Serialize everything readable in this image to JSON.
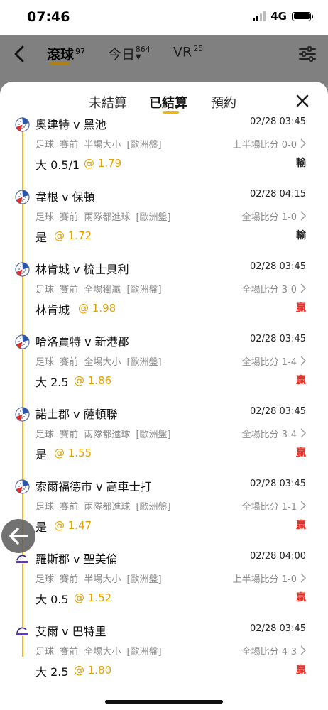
{
  "status": {
    "time": "07:46",
    "network": "4G"
  },
  "header": {
    "tabs": [
      {
        "label": "滾球",
        "count": "97",
        "active": true
      },
      {
        "label": "今日",
        "count": "864",
        "active": false
      },
      {
        "label": "VR",
        "count": "25",
        "active": false
      }
    ]
  },
  "sheet": {
    "tabs": [
      {
        "label": "未結算",
        "active": false
      },
      {
        "label": "已結算",
        "active": true
      },
      {
        "label": "預約",
        "active": false
      }
    ]
  },
  "bets": [
    {
      "teams": "奧建特 v 黑池",
      "date": "02/28 03:45",
      "sport": "足球",
      "period": "賽前",
      "market": "半場大小",
      "odds_type": "[歐洲盤]",
      "score": "上半場比分 0-0",
      "pick": "大 0.5/1",
      "odds": "@ 1.79",
      "result": "輸",
      "result_type": "loss",
      "ball": "volley"
    },
    {
      "teams": "韋根 v 保頓",
      "date": "02/28 04:15",
      "sport": "足球",
      "period": "賽前",
      "market": "兩隊都進球",
      "odds_type": "[歐洲盤]",
      "score": "全場比分 1-0",
      "pick": "是",
      "odds": "@ 1.72",
      "result": "輸",
      "result_type": "loss",
      "ball": "volley"
    },
    {
      "teams": "林肯城 v 梳士貝利",
      "date": "02/28 03:45",
      "sport": "足球",
      "period": "賽前",
      "market": "全場獨贏",
      "odds_type": "[歐洲盤]",
      "score": "全場比分 3-0",
      "pick": "林肯城",
      "odds": "@ 1.98",
      "result": "贏",
      "result_type": "win",
      "ball": "volley"
    },
    {
      "teams": "哈洛賈特 v 新港郡",
      "date": "02/28 03:45",
      "sport": "足球",
      "period": "賽前",
      "market": "全場大小",
      "odds_type": "[歐洲盤]",
      "score": "全場比分 1-4",
      "pick": "大 2.5",
      "odds": "@ 1.86",
      "result": "贏",
      "result_type": "win",
      "ball": "volley"
    },
    {
      "teams": "諾士郡 v 薩頓聯",
      "date": "02/28 03:45",
      "sport": "足球",
      "period": "賽前",
      "market": "兩隊都進球",
      "odds_type": "[歐洲盤]",
      "score": "全場比分 3-4",
      "pick": "是",
      "odds": "@ 1.55",
      "result": "贏",
      "result_type": "win",
      "ball": "volley"
    },
    {
      "teams": "索爾福德市 v 高車士打",
      "date": "02/28 03:45",
      "sport": "足球",
      "period": "賽前",
      "market": "兩隊都進球",
      "odds_type": "[歐洲盤]",
      "score": "全場比分 1-1",
      "pick": "是",
      "odds": "@ 1.47",
      "result": "贏",
      "result_type": "win",
      "ball": "volley"
    },
    {
      "teams": "羅斯郡 v 聖美倫",
      "date": "02/28 04:00",
      "sport": "足球",
      "period": "賽前",
      "market": "半場大小",
      "odds_type": "[歐洲盤]",
      "score": "上半場比分 1-0",
      "pick": "大 0.5",
      "odds": "@ 1.52",
      "result": "贏",
      "result_type": "win",
      "ball": "cinch"
    },
    {
      "teams": "艾爾 v 巴特里",
      "date": "02/28 03:45",
      "sport": "足球",
      "period": "賽前",
      "market": "全場大小",
      "odds_type": "[歐洲盤]",
      "score": "全場比分 4-3",
      "pick": "大 2.5",
      "odds": "@ 1.80",
      "result": "贏",
      "result_type": "win",
      "ball": "cinch"
    }
  ],
  "colors": {
    "accent": "#f5b800",
    "odds": "#e3a200",
    "win": "#e0342c",
    "loss": "#222222"
  }
}
